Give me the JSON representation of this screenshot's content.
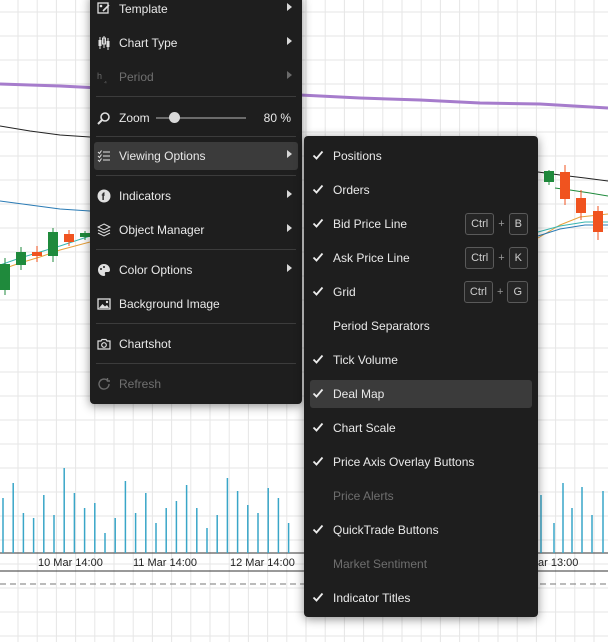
{
  "chart": {
    "time_labels": [
      "10 Mar 14:00",
      "11 Mar 14:00",
      "12 Mar 14:00",
      "ar 13:00"
    ],
    "colors": {
      "bull": "#1f8a3c",
      "bear": "#f0531f",
      "volume": "#39a6c8",
      "ma_purple": "#a67ccc"
    }
  },
  "main_menu": {
    "items": [
      {
        "label": "Template",
        "icon": "template-icon",
        "submenu": true
      },
      {
        "label": "Chart Type",
        "icon": "candlestick-icon",
        "submenu": true
      },
      {
        "label": "Period",
        "icon": "period-icon",
        "submenu": true,
        "disabled": true
      },
      {
        "label": "Zoom",
        "icon": "zoom-icon"
      },
      {
        "label": "Viewing Options",
        "icon": "list-check-icon",
        "submenu": true,
        "active": true
      },
      {
        "label": "Indicators",
        "icon": "indicators-icon",
        "submenu": true
      },
      {
        "label": "Object Manager",
        "icon": "layers-icon",
        "submenu": true
      },
      {
        "label": "Color Options",
        "icon": "palette-icon",
        "submenu": true
      },
      {
        "label": "Background Image",
        "icon": "image-icon"
      },
      {
        "label": "Chartshot",
        "icon": "camera-icon"
      },
      {
        "label": "Refresh",
        "icon": "refresh-icon",
        "disabled": true
      }
    ],
    "zoom_value": "80 %",
    "zoom_level": 0.2
  },
  "viewing_options": {
    "items": [
      {
        "label": "Positions",
        "checked": true
      },
      {
        "label": "Orders",
        "checked": true
      },
      {
        "label": "Bid Price Line",
        "checked": true,
        "shortcut": [
          "Ctrl",
          "+",
          "B"
        ]
      },
      {
        "label": "Ask Price Line",
        "checked": true,
        "shortcut": [
          "Ctrl",
          "+",
          "K"
        ]
      },
      {
        "label": "Grid",
        "checked": true,
        "shortcut": [
          "Ctrl",
          "+",
          "G"
        ]
      },
      {
        "label": "Period Separators",
        "checked": false
      },
      {
        "label": "Tick Volume",
        "checked": true
      },
      {
        "label": "Deal Map",
        "checked": true,
        "active": true
      },
      {
        "label": "Chart Scale",
        "checked": true
      },
      {
        "label": "Price Axis Overlay Buttons",
        "checked": true
      },
      {
        "label": "Price Alerts",
        "checked": false,
        "disabled": true
      },
      {
        "label": "QuickTrade Buttons",
        "checked": true
      },
      {
        "label": "Market Sentiment",
        "checked": false,
        "disabled": true
      },
      {
        "label": "Indicator Titles",
        "checked": true
      }
    ]
  }
}
